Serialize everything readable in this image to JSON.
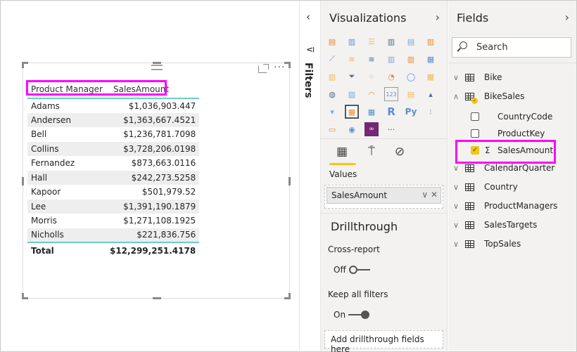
{
  "canvas": {
    "table": {
      "columns": [
        "Product Manager",
        "SalesAmount"
      ],
      "rows": [
        {
          "name": "Adams",
          "amount": "$1,036,903.447"
        },
        {
          "name": "Andersen",
          "amount": "$1,363,667.4521"
        },
        {
          "name": "Bell",
          "amount": "$1,236,781.7098"
        },
        {
          "name": "Collins",
          "amount": "$3,728,206.0198"
        },
        {
          "name": "Fernandez",
          "amount": "$873,663.0116"
        },
        {
          "name": "Hall",
          "amount": "$242,273.5258"
        },
        {
          "name": "Kapoor",
          "amount": "$501,979.52"
        },
        {
          "name": "Lee",
          "amount": "$1,391,190.1879"
        },
        {
          "name": "Morris",
          "amount": "$1,271,108.1925"
        },
        {
          "name": "Nicholls",
          "amount": "$221,836.756"
        }
      ],
      "total_label": "Total",
      "total_value": "$12,299,251.4178"
    },
    "more_options": "···",
    "highlight_color": "#ff00ff",
    "accent_line_color": "#6fcdc4"
  },
  "filters": {
    "label": "Filters",
    "collapse_icon": "‹",
    "funnel_icon": "⊽"
  },
  "visualizations": {
    "title": "Visualizations",
    "expand_icon": "›",
    "icons": [
      {
        "name": "stacked-bar-chart-icon",
        "glyph": "▤"
      },
      {
        "name": "stacked-column-chart-icon",
        "glyph": "▥"
      },
      {
        "name": "clustered-bar-chart-icon",
        "glyph": "☰"
      },
      {
        "name": "clustered-column-chart-icon",
        "glyph": "▥"
      },
      {
        "name": "100-stacked-bar-chart-icon",
        "glyph": "▤"
      },
      {
        "name": "100-stacked-column-chart-icon",
        "glyph": "▥"
      },
      {
        "name": "line-chart-icon",
        "glyph": "⟋"
      },
      {
        "name": "area-chart-icon",
        "glyph": "≋"
      },
      {
        "name": "stacked-area-chart-icon",
        "glyph": "≋"
      },
      {
        "name": "line-and-stacked-column-chart-icon",
        "glyph": "▥"
      },
      {
        "name": "line-and-clustered-column-chart-icon",
        "glyph": "▥"
      },
      {
        "name": "ribbon-chart-icon",
        "glyph": "▦"
      },
      {
        "name": "waterfall-chart-icon",
        "glyph": "▥"
      },
      {
        "name": "funnel-chart-icon",
        "glyph": "⏷"
      },
      {
        "name": "scatter-chart-icon",
        "glyph": "⁘"
      },
      {
        "name": "pie-chart-icon",
        "glyph": "◔"
      },
      {
        "name": "donut-chart-icon",
        "glyph": "◯"
      },
      {
        "name": "treemap-icon",
        "glyph": "▦"
      },
      {
        "name": "map-icon",
        "glyph": "◍"
      },
      {
        "name": "filled-map-icon",
        "glyph": "▧"
      },
      {
        "name": "gauge-icon",
        "glyph": "◠"
      },
      {
        "name": "card-icon",
        "glyph": "123"
      },
      {
        "name": "multi-row-card-icon",
        "glyph": "▤"
      },
      {
        "name": "kpi-icon",
        "glyph": "▴"
      },
      {
        "name": "slicer-icon",
        "glyph": "▾"
      },
      {
        "name": "table-icon",
        "glyph": "▦"
      },
      {
        "name": "matrix-icon",
        "glyph": "▦"
      },
      {
        "name": "r-script-visual-icon",
        "glyph": "R"
      },
      {
        "name": "python-visual-icon",
        "glyph": "Py"
      },
      {
        "name": "key-influencers-icon",
        "glyph": "⁝"
      },
      {
        "name": "q-and-a-icon",
        "glyph": "▭"
      },
      {
        "name": "arcgis-map-icon",
        "glyph": "◉"
      },
      {
        "name": "power-apps-icon",
        "glyph": "∞"
      },
      {
        "name": "more-visuals-icon",
        "glyph": "···"
      }
    ],
    "selected_icon_index": 25,
    "tabs": [
      {
        "name": "fields-tab",
        "glyph": "▦"
      },
      {
        "name": "format-tab",
        "glyph": "⍑"
      },
      {
        "name": "analytics-tab",
        "glyph": "⊘"
      }
    ],
    "values_label": "Values",
    "values_field": "SalesAmount",
    "chip_controls": "∨  ✕",
    "drillthrough": {
      "title": "Drillthrough",
      "cross_report_label": "Cross-report",
      "cross_report_state": "Off",
      "keep_filters_label": "Keep all filters",
      "keep_filters_state": "On",
      "add_fields_placeholder": "Add drillthrough fields here"
    },
    "accent_color": "#f2c811"
  },
  "fields": {
    "title": "Fields",
    "expand_icon": "›",
    "search_placeholder": "Search",
    "tables": [
      {
        "name": "Bike",
        "expanded": false
      },
      {
        "name": "BikeSales",
        "expanded": true,
        "children": [
          {
            "name": "CountryCode",
            "checked": false
          },
          {
            "name": "ProductKey",
            "checked": false
          },
          {
            "name": "SalesAmount",
            "checked": true,
            "sigma": "Σ"
          }
        ]
      },
      {
        "name": "CalendarQuarter",
        "expanded": false
      },
      {
        "name": "Country",
        "expanded": false
      },
      {
        "name": "ProductManagers",
        "expanded": false
      },
      {
        "name": "SalesTargets",
        "expanded": false
      },
      {
        "name": "TopSales",
        "expanded": false
      }
    ],
    "chevron_collapsed": "∨",
    "chevron_expanded": "∧",
    "check_glyph": "✓"
  }
}
